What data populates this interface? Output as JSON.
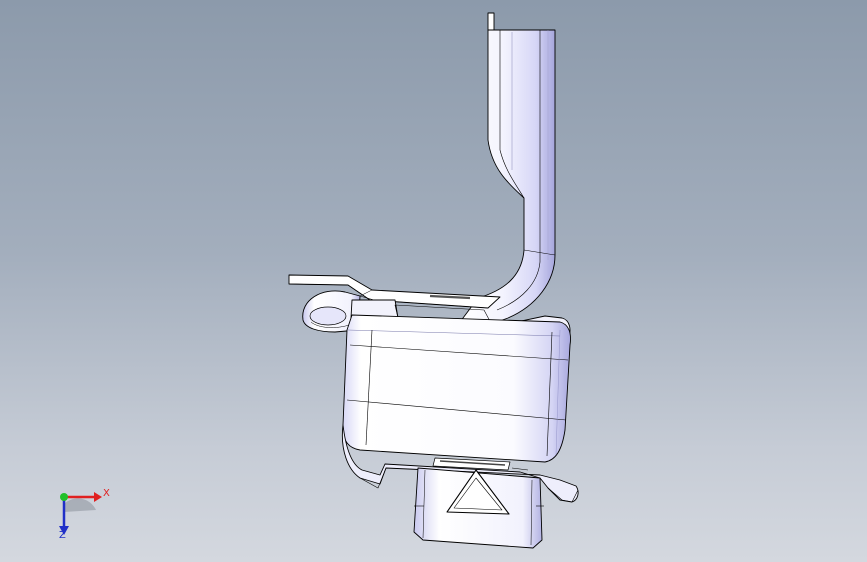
{
  "viewport": {
    "background_top": "#8c9aab",
    "background_bottom": "#d4d8df"
  },
  "part": {
    "face_color": "#ffffff",
    "shade_color": "#cdcdf4",
    "deep_shade_color": "#9f9fd6",
    "edge_color": "#000000"
  },
  "triad": {
    "x_label": "X",
    "z_label": "Z",
    "x_color": "#e02020",
    "y_color": "#22c02a",
    "z_color": "#2030c8",
    "x_icon": "x-axis-arrow-icon",
    "y_icon": "y-axis-dot-icon",
    "z_icon": "z-axis-arrow-icon"
  }
}
